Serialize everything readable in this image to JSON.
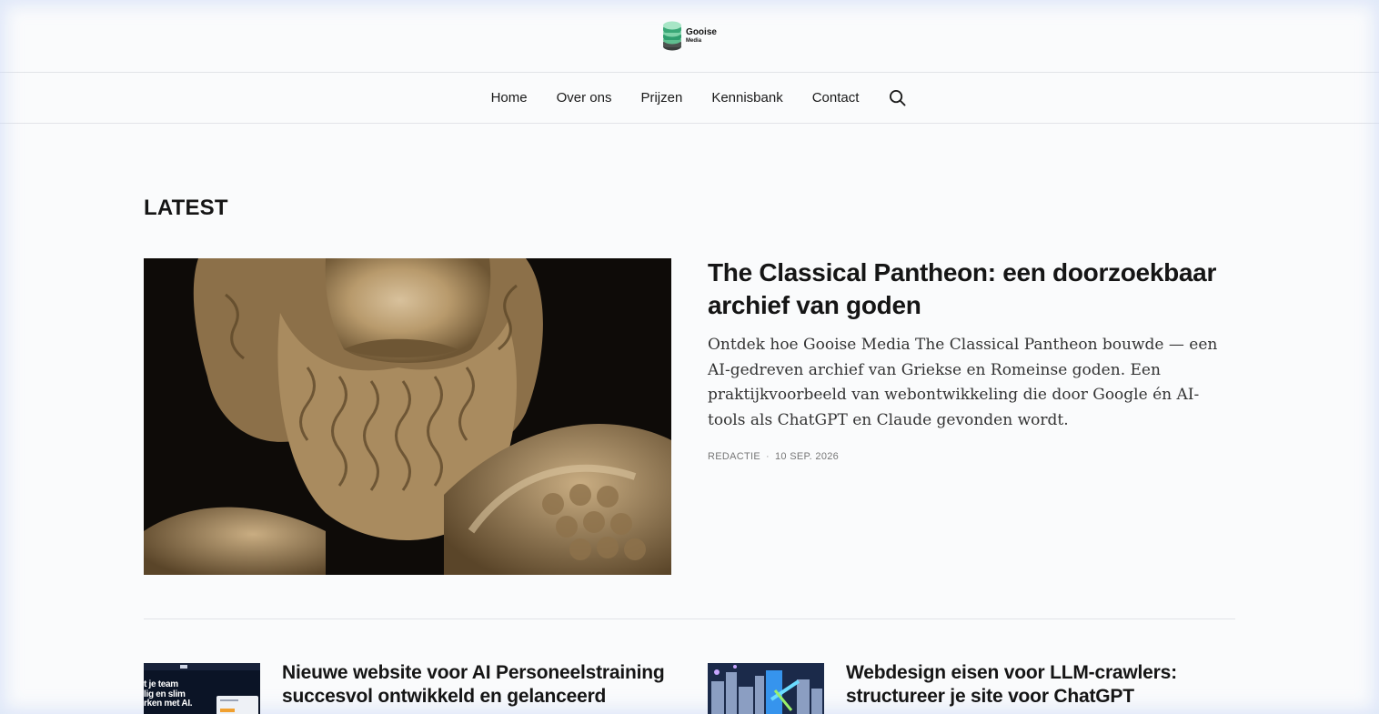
{
  "header": {
    "logo_line1": "Gooise",
    "logo_line2": "Media"
  },
  "nav": {
    "items": [
      {
        "label": "Home"
      },
      {
        "label": "Over ons"
      },
      {
        "label": "Prijzen"
      },
      {
        "label": "Kennisbank"
      },
      {
        "label": "Contact"
      }
    ],
    "search_icon": "search-icon"
  },
  "section": {
    "title": "LATEST"
  },
  "featured": {
    "title": "The Classical Pantheon: een doorzoekbaar archief van goden",
    "excerpt": "Ontdek hoe Gooise Media The Classical Pantheon bouwde — een AI-gedreven archief van Griekse en Romeinse goden. Een praktijkvoorbeeld van webontwikkeling die door Google én AI-tools als ChatGPT en Claude gevonden wordt.",
    "author": "REDACTIE",
    "separator": "·",
    "date": "10 SEP. 2026"
  },
  "cards": [
    {
      "title": "Nieuwe website voor AI Personeelstraining succesvol ontwikkeld en gelanceerd",
      "thumb_text_1": "t je team",
      "thumb_text_2": "lig en slim",
      "thumb_text_3": "rken met AI."
    },
    {
      "title": "Webdesign eisen voor LLM-crawlers: structureer je site voor ChatGPT"
    }
  ],
  "colors": {
    "accent_green": "#2f9e6e",
    "text": "#151515",
    "meta": "#777777"
  }
}
